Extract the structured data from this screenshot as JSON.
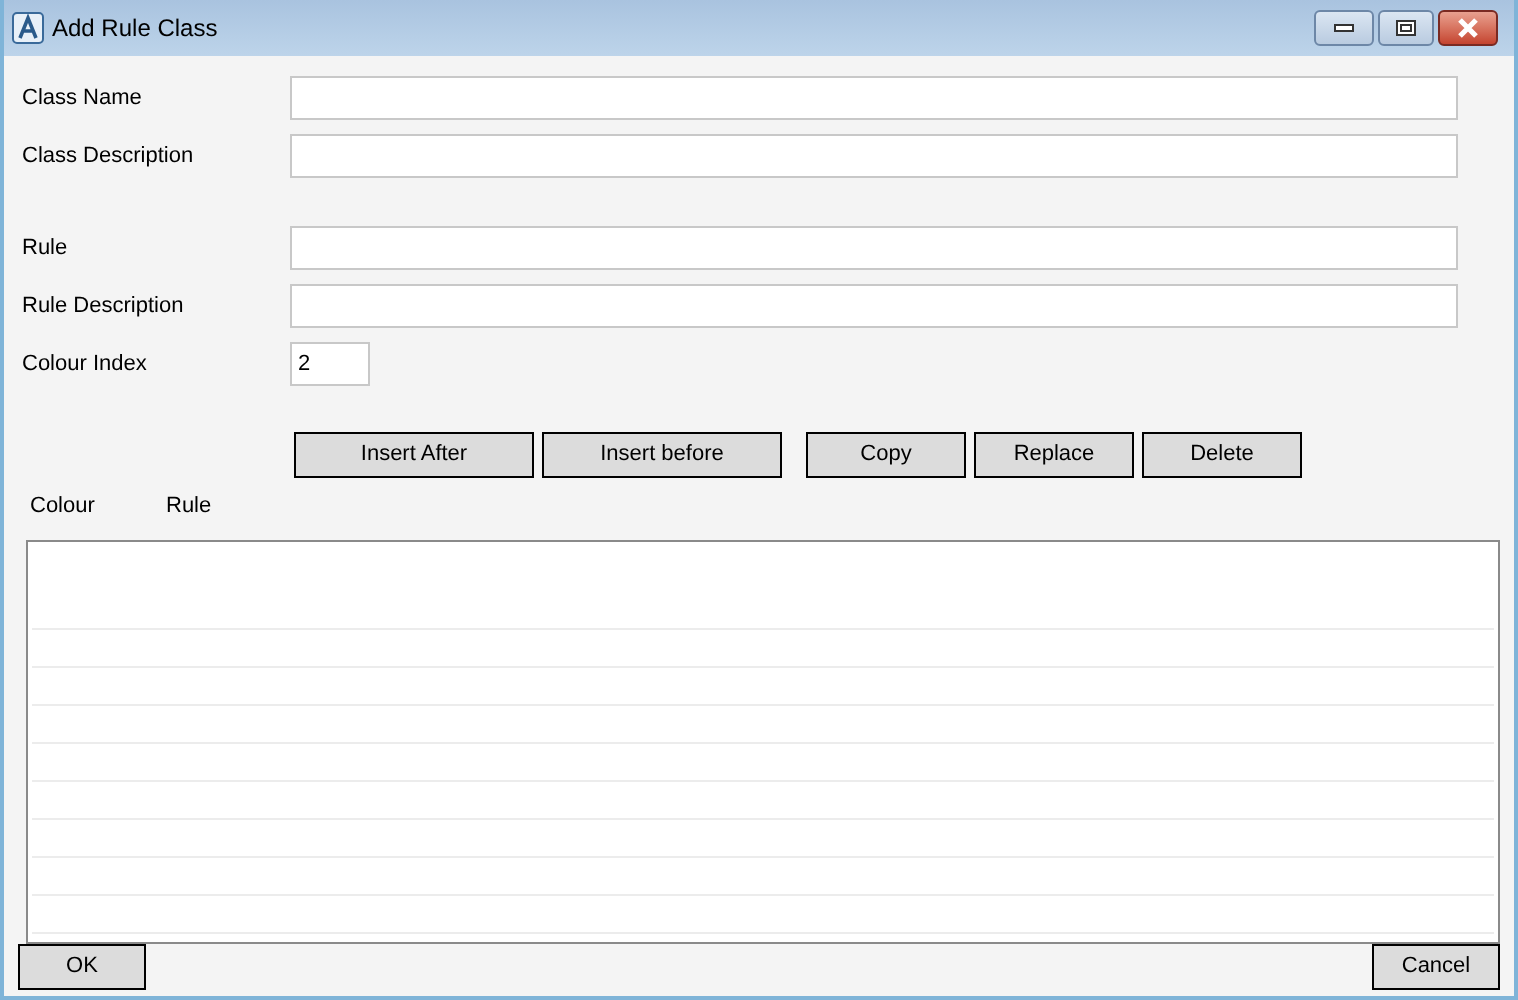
{
  "window": {
    "title": "Add Rule Class"
  },
  "fields": [
    {
      "label": "Class Name"
    },
    {
      "label": "Class Description"
    },
    {
      "label": "Rule"
    },
    {
      "label": "Rule Description"
    },
    {
      "label": "Colour Index",
      "value": "2"
    }
  ],
  "buttons": [
    "Insert After",
    "Insert before",
    "Copy",
    "Replace",
    "Delete"
  ],
  "list": {
    "columns": [
      "Colour",
      "Rule"
    ]
  },
  "footer_buttons": [
    "OK",
    "Cancel"
  ]
}
